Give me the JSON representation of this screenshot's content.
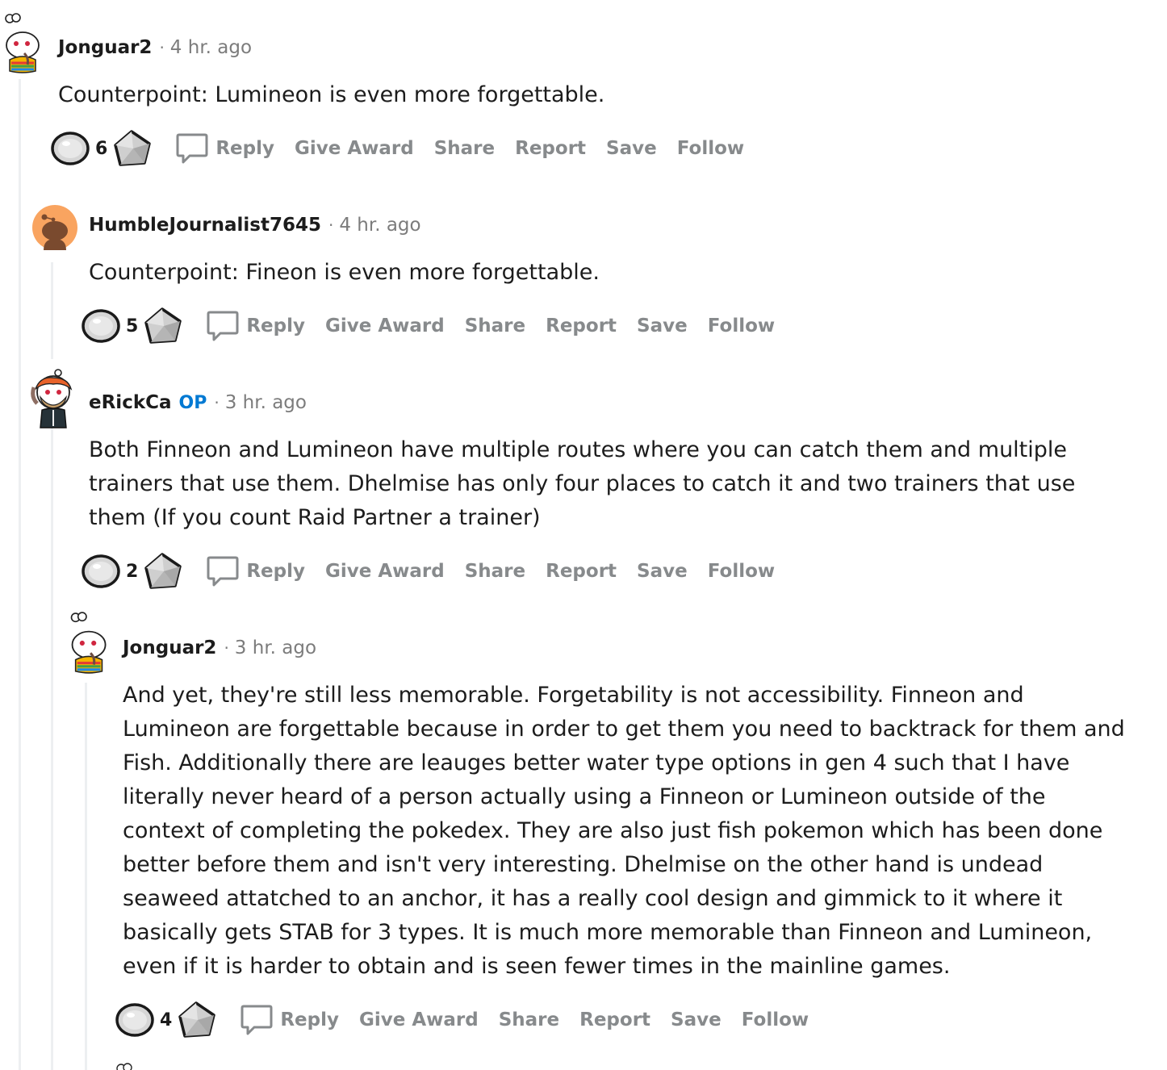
{
  "comments": [
    {
      "username": "Jonguar2",
      "op_badge": "",
      "time": "4 hr. ago",
      "body": "Counterpoint: Lumineon is even more forgettable.",
      "score": "6",
      "actions": [
        "Reply",
        "Give Award",
        "Share",
        "Report",
        "Save",
        "Follow"
      ]
    },
    {
      "username": "HumbleJournalist7645",
      "op_badge": "",
      "time": "4 hr. ago",
      "body": "Counterpoint: Fineon is even more forgettable.",
      "score": "5",
      "actions": [
        "Reply",
        "Give Award",
        "Share",
        "Report",
        "Save",
        "Follow"
      ]
    },
    {
      "username": "eRickCa",
      "op_badge": "OP",
      "time": "3 hr. ago",
      "body": "Both Finneon and Lumineon have multiple routes where you can catch them and multiple trainers that use them. Dhelmise has only four places to catch it and two trainers that use them (If you count Raid Partner a trainer)",
      "score": "2",
      "actions": [
        "Reply",
        "Give Award",
        "Share",
        "Report",
        "Save",
        "Follow"
      ]
    },
    {
      "username": "Jonguar2",
      "op_badge": "",
      "time": "3 hr. ago",
      "body": "And yet, they're still less memorable. Forgetability is not accessibility. Finneon and Lumineon are forgettable because in order to get them you need to backtrack for them and Fish. Additionally there are leauges better water type options in gen 4 such that I have literally never heard of a person actually using a Finneon or Lumineon outside of the context of completing the pokedex. They are also just fish pokemon which has been done better before them and isn't very interesting. Dhelmise on the other hand is undead seaweed attatched to an anchor, it has a really cool design and gimmick to it where it basically gets STAB for 3 types. It is much more memorable than Finneon and Lumineon, even if it is harder to obtain and is seen fewer times in the mainline games.",
      "score": "4",
      "actions": [
        "Reply",
        "Give Award",
        "Share",
        "Report",
        "Save",
        "Follow"
      ]
    }
  ],
  "icons": {
    "upvote": "gem-upvote-icon",
    "downvote": "gem-downvote-icon",
    "reply": "speech-bubble-icon"
  },
  "colors": {
    "op_badge": "#0079d3",
    "meta_text": "#7c7c7c",
    "action_text": "#878a8c",
    "thread_line": "#edeff1",
    "avatar_orange": "#f9a460"
  }
}
